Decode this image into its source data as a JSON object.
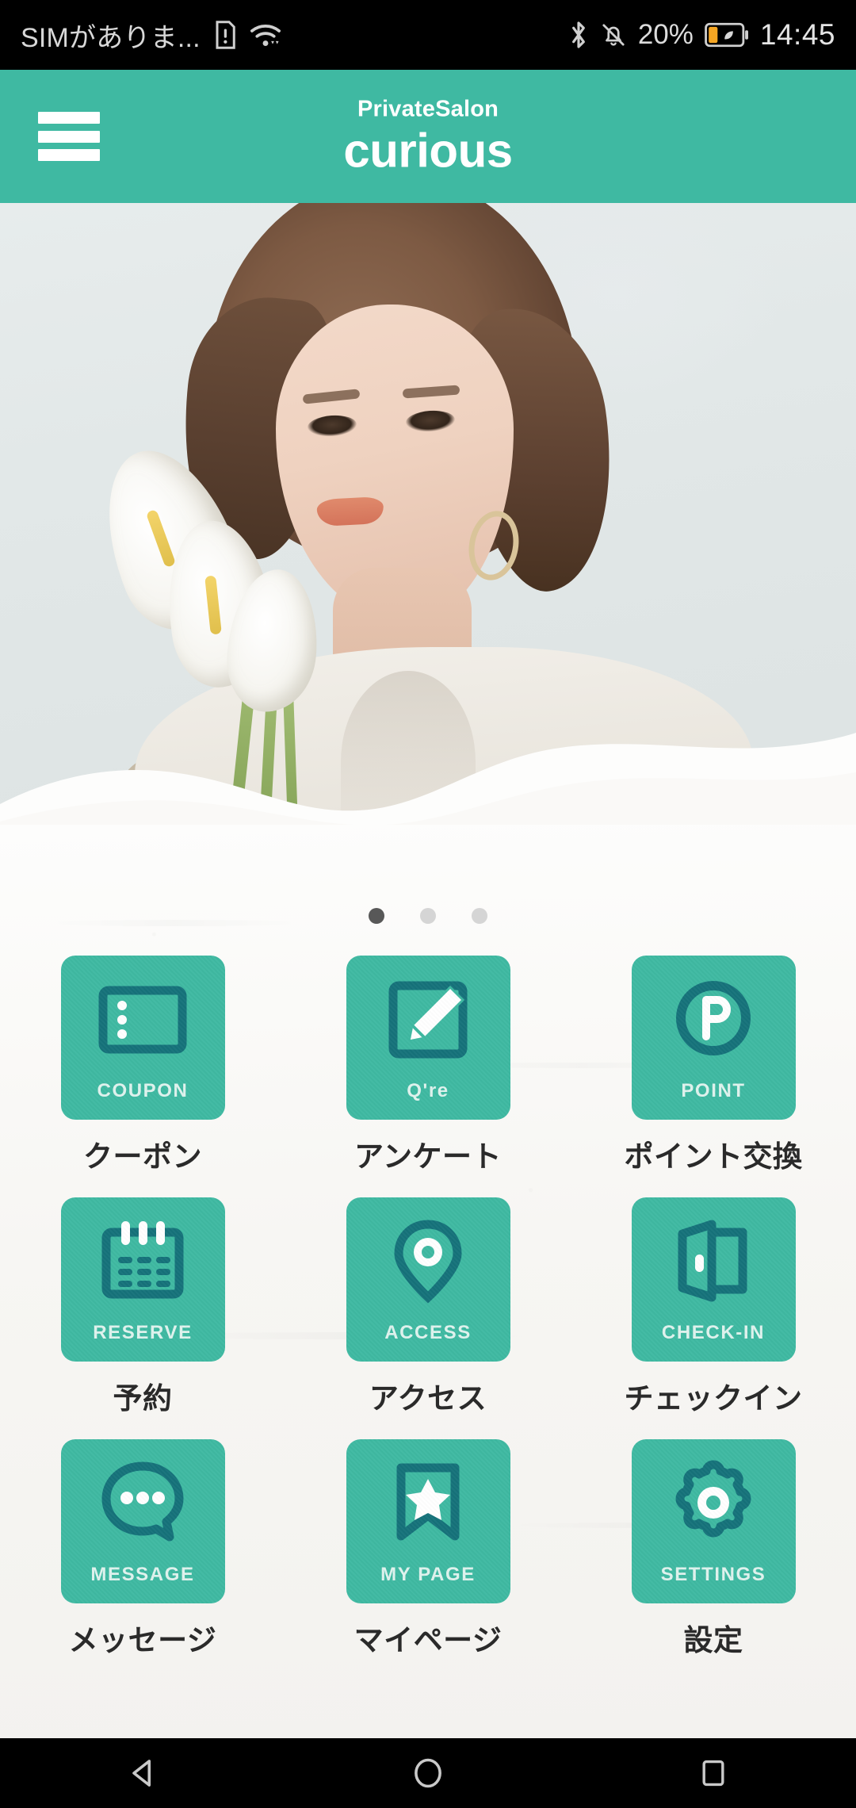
{
  "status_bar": {
    "carrier_text": "SIMがありま...",
    "icons": [
      "sim-card-alert-icon",
      "wifi-icon",
      "bluetooth-icon",
      "notifications-muted-icon"
    ],
    "battery_percent": "20%",
    "battery_icon": "battery-saver-icon",
    "time": "14:45"
  },
  "header": {
    "menu_icon": "hamburger-menu-icon",
    "logo_sup": "PrivateSalon",
    "logo_main": "curious",
    "background_color": "#3fb9a2"
  },
  "hero": {
    "alt": "salon model portrait with calla lilies"
  },
  "carousel": {
    "total_dots": 3,
    "active_index": 0,
    "active_color": "#585858",
    "inactive_color": "#d5d5d5"
  },
  "grid": {
    "tile_color": "#3fb9a2",
    "icon_color": "#15727a",
    "items": [
      {
        "icon": "coupon-ticket-icon",
        "caption": "COUPON",
        "label": "クーポン"
      },
      {
        "icon": "pencil-square-icon",
        "caption": "Q're",
        "label": "アンケート"
      },
      {
        "icon": "point-p-circle-icon",
        "caption": "POINT",
        "label": "ポイント交換"
      },
      {
        "icon": "calendar-icon",
        "caption": "RESERVE",
        "label": "予約"
      },
      {
        "icon": "map-pin-icon",
        "caption": "ACCESS",
        "label": "アクセス"
      },
      {
        "icon": "open-door-icon",
        "caption": "CHECK-IN",
        "label": "チェックイン"
      },
      {
        "icon": "speech-bubble-icon",
        "caption": "MESSAGE",
        "label": "メッセージ"
      },
      {
        "icon": "bookmark-star-icon",
        "caption": "MY PAGE",
        "label": "マイページ"
      },
      {
        "icon": "gear-icon",
        "caption": "SETTINGS",
        "label": "設定"
      }
    ]
  },
  "nav_bar": {
    "back": "back-triangle-icon",
    "home": "home-circle-icon",
    "recents": "recents-square-icon"
  }
}
